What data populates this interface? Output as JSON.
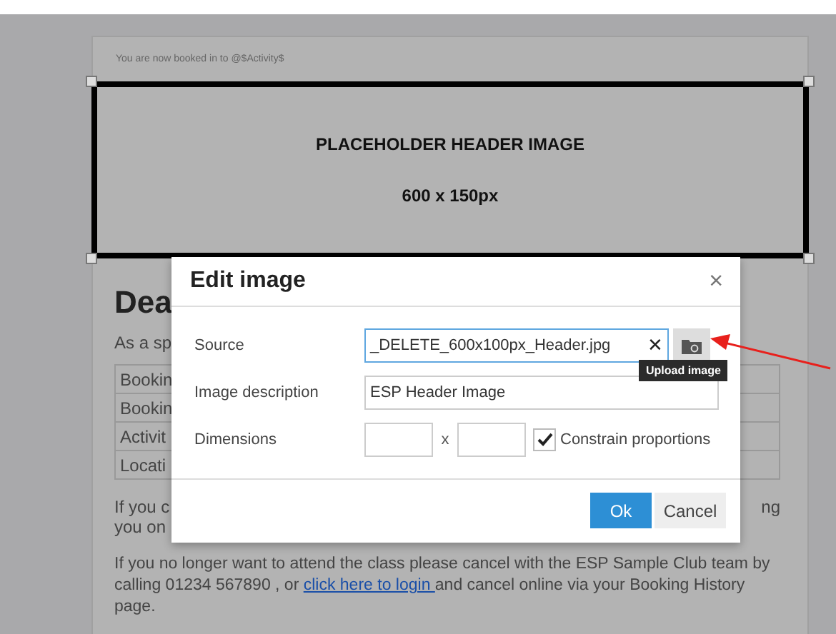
{
  "email": {
    "booked_line": "You are now booked in to @$Activity$",
    "header_image": {
      "title": "PLACEHOLDER HEADER IMAGE",
      "size": "600 x 150px"
    },
    "heading": "Dea",
    "intro": "As a sp",
    "table_rows": [
      {
        "label": "Bookin"
      },
      {
        "label": "Bookin"
      },
      {
        "label": "Activit"
      },
      {
        "label": "Locati"
      }
    ],
    "note_left": "If you c",
    "note_right": "ng",
    "note_line2": "you on",
    "cancel_text_before": "If you no longer want to attend the class please cancel with the ESP Sample Club team by calling 01234 567890 , or",
    "cancel_link": "click here to login ",
    "cancel_text_after": "and cancel online via your Booking History page."
  },
  "dialog": {
    "title": "Edit image",
    "close": "×",
    "source_label": "Source",
    "source_value": "_DELETE_600x100px_Header.jpg",
    "clear": "✕",
    "tooltip": "Upload image",
    "description_label": "Image description",
    "description_value": "ESP Header Image",
    "dimensions_label": "Dimensions",
    "times": "x",
    "constrain_label": "Constrain proportions",
    "constrain_checked": true,
    "ok": "Ok",
    "cancel": "Cancel"
  }
}
